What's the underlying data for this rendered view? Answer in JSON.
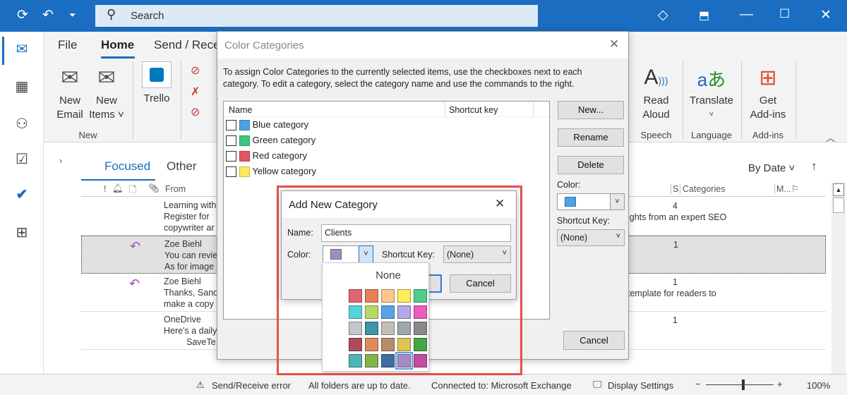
{
  "titlebar": {
    "search_placeholder": "Search"
  },
  "ribbon": {
    "tabs": [
      "File",
      "Home",
      "Send / Rece"
    ],
    "new_email": [
      "New",
      "Email"
    ],
    "new_items": [
      "New",
      "Items ˅"
    ],
    "trello": "Trello",
    "group_new": "New",
    "read_aloud": [
      "Read",
      "Aloud"
    ],
    "translate": "Translate",
    "get_addins": [
      "Get",
      "Add-ins"
    ],
    "group_speech": "Speech",
    "group_language": "Language",
    "group_addins": "Add-ins"
  },
  "mail": {
    "tabs": [
      "Focused",
      "Other"
    ],
    "sort": "By Date",
    "columns": {
      "from": "From",
      "size": "S",
      "categories": "Categories",
      "mentions": "M..."
    },
    "rows": [
      {
        "from": "Learning with",
        "line2": "Register for",
        "line3": "copywriter ar",
        "count": "4",
        "right": "ights from an expert SEO",
        "reply": false,
        "selected": false
      },
      {
        "from": "Zoe Biehl",
        "line2": "You can revie",
        "line3": "As for image",
        "count": "1",
        "right": "",
        "reply": true,
        "selected": true
      },
      {
        "from": "Zoe Biehl",
        "line2": "Thanks, Sand",
        "line3": "make a copy",
        "count": "1",
        "right": "template for readers to",
        "reply": true,
        "selected": false
      },
      {
        "from": "OneDrive",
        "line2": "Here's a daily",
        "line3": "SaveTe",
        "count": "1",
        "right": "",
        "reply": false,
        "selected": false
      }
    ]
  },
  "color_categories": {
    "title": "Color Categories",
    "instructions": "To assign Color Categories to the currently selected items, use the checkboxes next to each category.  To edit a category, select the category name and use the commands to the right.",
    "col_name": "Name",
    "col_shortcut": "Shortcut key",
    "categories": [
      {
        "name": "Blue category",
        "color": "#4ea1e3"
      },
      {
        "name": "Green category",
        "color": "#3fc47f"
      },
      {
        "name": "Red category",
        "color": "#e05561"
      },
      {
        "name": "Yellow category",
        "color": "#fde95a"
      }
    ],
    "buttons": {
      "new": "New...",
      "rename": "Rename",
      "delete": "Delete",
      "cancel": "Cancel"
    },
    "color_label": "Color:",
    "color_value": "#4ea1e3",
    "shortcut_label": "Shortcut Key:",
    "shortcut_value": "(None)"
  },
  "add_category": {
    "title": "Add New Category",
    "name_label": "Name:",
    "name_value": "Clients",
    "color_label": "Color:",
    "color_value": "#a68ac8",
    "shortcut_label": "Shortcut Key:",
    "shortcut_value": "(None)",
    "cancel": "Cancel",
    "palette_none": "None",
    "palette": [
      [
        "#e06670",
        "#eb7f56",
        "#fdc98a",
        "#fded5a",
        "#4fcd8a"
      ],
      [
        "#56d4de",
        "#b7d866",
        "#5aa3e8",
        "#b2a8ea",
        "#ec5dba"
      ],
      [
        "#c0c8cb",
        "#3d95a8",
        "#c2c0b4",
        "#9ea8aa",
        "#8a8a8a"
      ],
      [
        "#ad4b5e",
        "#e08a5d",
        "#b98a6c",
        "#dec553",
        "#45a447"
      ],
      [
        "#4db5b5",
        "#84b24b",
        "#3e6fa0",
        "#a68ac8",
        "#c44b9d"
      ]
    ],
    "selected": [
      4,
      3
    ]
  },
  "status": {
    "error": "Send/Receive error",
    "folders": "All folders are up to date.",
    "connected": "Connected to: Microsoft Exchange",
    "display": "Display Settings",
    "zoom": "100%",
    "zoom_fraction": 0.55
  },
  "highlight_color": "#e8504a"
}
